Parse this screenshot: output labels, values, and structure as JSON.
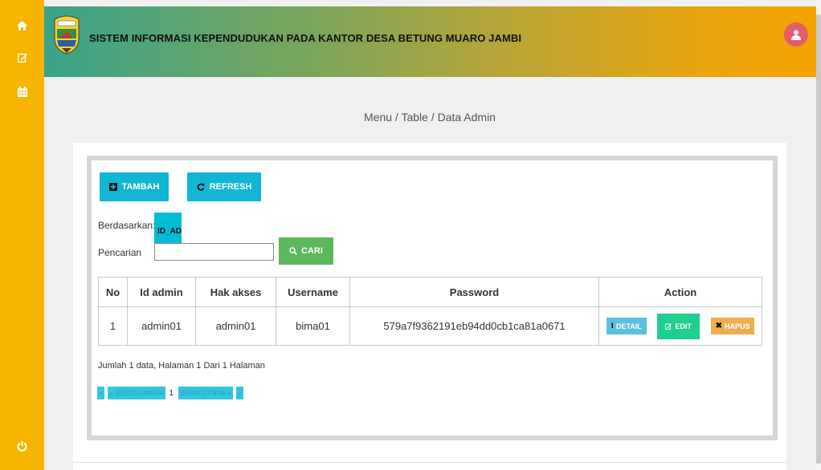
{
  "header": {
    "title": "SISTEM INFORMASI KEPENDUDUKAN PADA KANTOR DESA BETUNG MUARO JAMBI"
  },
  "sidebar": {
    "icons": [
      "home-icon",
      "edit-icon",
      "calendar-icon",
      "power-icon"
    ]
  },
  "breadcrumb": "Menu / Table / Data Admin",
  "toolbar": {
    "add_label": "TAMBAH",
    "refresh_label": "REFRESH"
  },
  "filter": {
    "by_label": "Berdasarkan:",
    "by_value": "ID_AD",
    "search_label": "Pencarian",
    "search_button": "CARI",
    "search_value": ""
  },
  "table": {
    "headers": [
      "No",
      "Id admin",
      "Hak akses",
      "Username",
      "Password",
      "Action"
    ],
    "rows": [
      {
        "no": "1",
        "id_admin": "admin01",
        "hak_akses": "admin01",
        "username": "bima01",
        "password": "579a7f9362191eb94dd0cb1ca81a0671",
        "actions": {
          "detail": "DETAIL",
          "edit": "EDIT",
          "hapus": "HAPUS"
        }
      }
    ]
  },
  "summary": "Jumlah 1 data, Halaman 1 Dari 1 Halaman",
  "pager": {
    "first": "«",
    "prev": "« SEBELUMNYA",
    "current": "1",
    "next": "BERIKUTNYA »",
    "last": "»"
  },
  "colors": {
    "sidebar": "#f7b500",
    "primary": "#11b6d4",
    "success": "#5cb85c",
    "edit": "#1ecf8e",
    "warning": "#f0ad4e",
    "avatar": "#e35d6a"
  }
}
